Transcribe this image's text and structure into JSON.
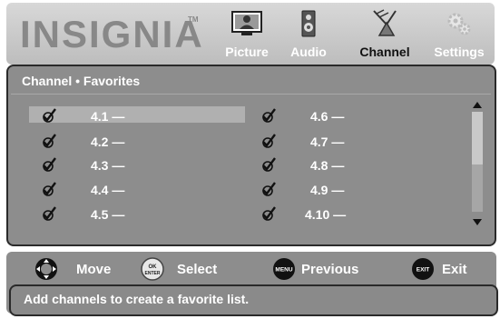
{
  "brand": {
    "name": "INSIGNIA",
    "trademark": "TM"
  },
  "tabs": [
    {
      "label": "Picture",
      "icon": "picture-icon",
      "active": false
    },
    {
      "label": "Audio",
      "icon": "speaker-icon",
      "active": false
    },
    {
      "label": "Channel",
      "icon": "antenna-icon",
      "active": true
    },
    {
      "label": "Settings",
      "icon": "gears-icon",
      "active": false
    }
  ],
  "panel": {
    "title": "Channel • Favorites"
  },
  "favorites": {
    "left": [
      {
        "channel": "4.1 —",
        "checked": true,
        "selected": true
      },
      {
        "channel": "4.2 —",
        "checked": true,
        "selected": false
      },
      {
        "channel": "4.3 —",
        "checked": true,
        "selected": false
      },
      {
        "channel": "4.4 —",
        "checked": true,
        "selected": false
      },
      {
        "channel": "4.5 —",
        "checked": true,
        "selected": false
      }
    ],
    "right": [
      {
        "channel": "4.6 —",
        "checked": true
      },
      {
        "channel": "4.7 —",
        "checked": true
      },
      {
        "channel": "4.8 —",
        "checked": true
      },
      {
        "channel": "4.9 —",
        "checked": true
      },
      {
        "channel": "4.10 —",
        "checked": true
      }
    ]
  },
  "help": {
    "move": "Move",
    "select": "Select",
    "select_button_text": [
      "OK",
      "ENTER"
    ],
    "previous": "Previous",
    "previous_button_text": "MENU",
    "exit": "Exit",
    "exit_button_text": "EXIT"
  },
  "message": "Add channels to create a favorite list.",
  "colors": {
    "header_bg": "#cccccc",
    "panel_bg": "#8d8d8d",
    "highlight": "#b0b0b0",
    "text": "#ffffff",
    "active_tab_text": "#111111"
  }
}
